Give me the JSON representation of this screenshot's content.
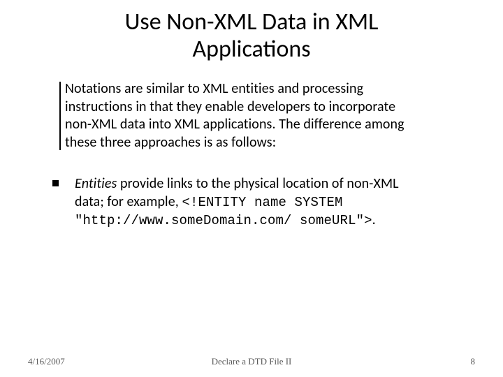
{
  "title_line1": "Use Non-XML Data  in XML",
  "title_line2": "Applications",
  "para1": "Notations are similar to XML entities and processing instructions in that they enable developers to incorporate non-XML data into XML applications. The difference among these three approaches is as follows:",
  "para2_lead": "Entities",
  "para2_rest": " provide links to the physical location of non-XML data; for example, ",
  "para2_code": "<!ENTITY name SYSTEM \"http://www.someDomain.com/ someURL\">",
  "para2_tail": ".",
  "footer": {
    "date": "4/16/2007",
    "center": "Declare a DTD File II",
    "page": "8"
  }
}
